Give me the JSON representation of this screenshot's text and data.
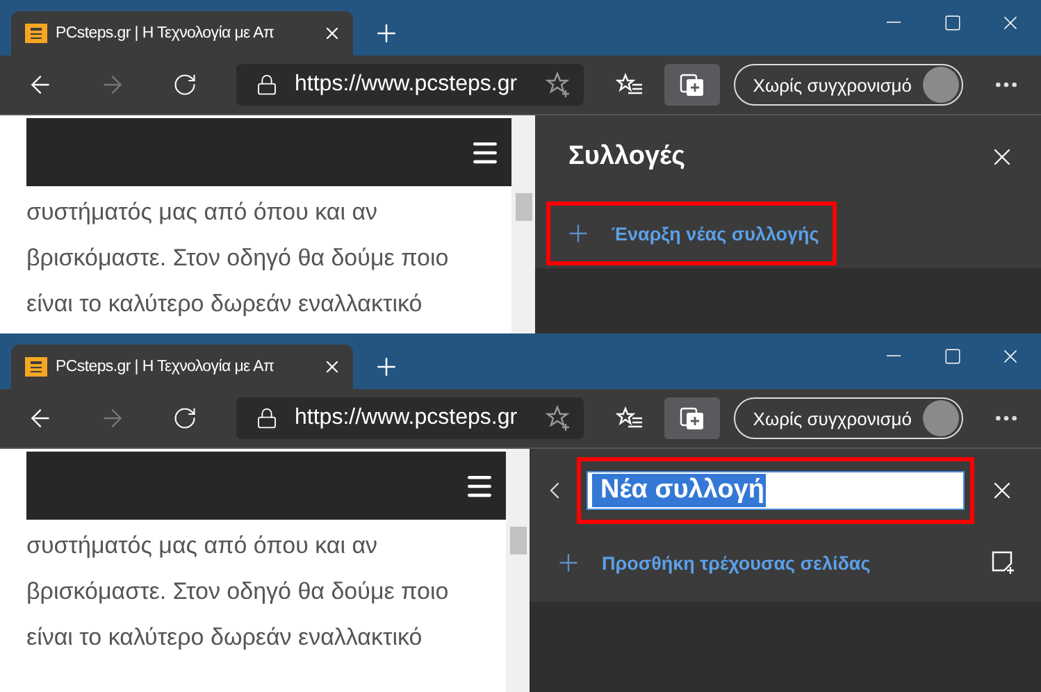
{
  "shots": [
    {
      "tab": {
        "title": "PCsteps.gr | Η Τεχνολογία με Απ",
        "selected": true
      },
      "address": "https://www.pcsteps.gr",
      "collections_selected": true,
      "sync_label": "Χωρίς συγχρονισμό",
      "article_lines": [
        "συστήματός μας από όπου και αν",
        "βρισκόμαστε. Στον οδηγό θα δούμε ποιο",
        "είναι το καλύτερο δωρεάν εναλλακτικό"
      ],
      "panel": {
        "kind": "list",
        "title": "Συλλογές",
        "action": "Έναρξη νέας συλλογής"
      }
    },
    {
      "tab": {
        "title": "PCsteps.gr | Η Τεχνολογία με Απ",
        "selected": true
      },
      "address": "https://www.pcsteps.gr",
      "collections_selected": true,
      "sync_label": "Χωρίς συγχρονισμό",
      "article_lines": [
        "συστήματός μας από όπου και αν",
        "βρισκόμαστε. Στον οδηγό θα δούμε ποιο",
        "είναι το καλύτερο δωρεάν εναλλακτικό"
      ],
      "panel": {
        "kind": "new",
        "name_value": "Νέα συλλογή",
        "action": "Προσθήκη τρέχουσας σελίδας"
      }
    }
  ]
}
